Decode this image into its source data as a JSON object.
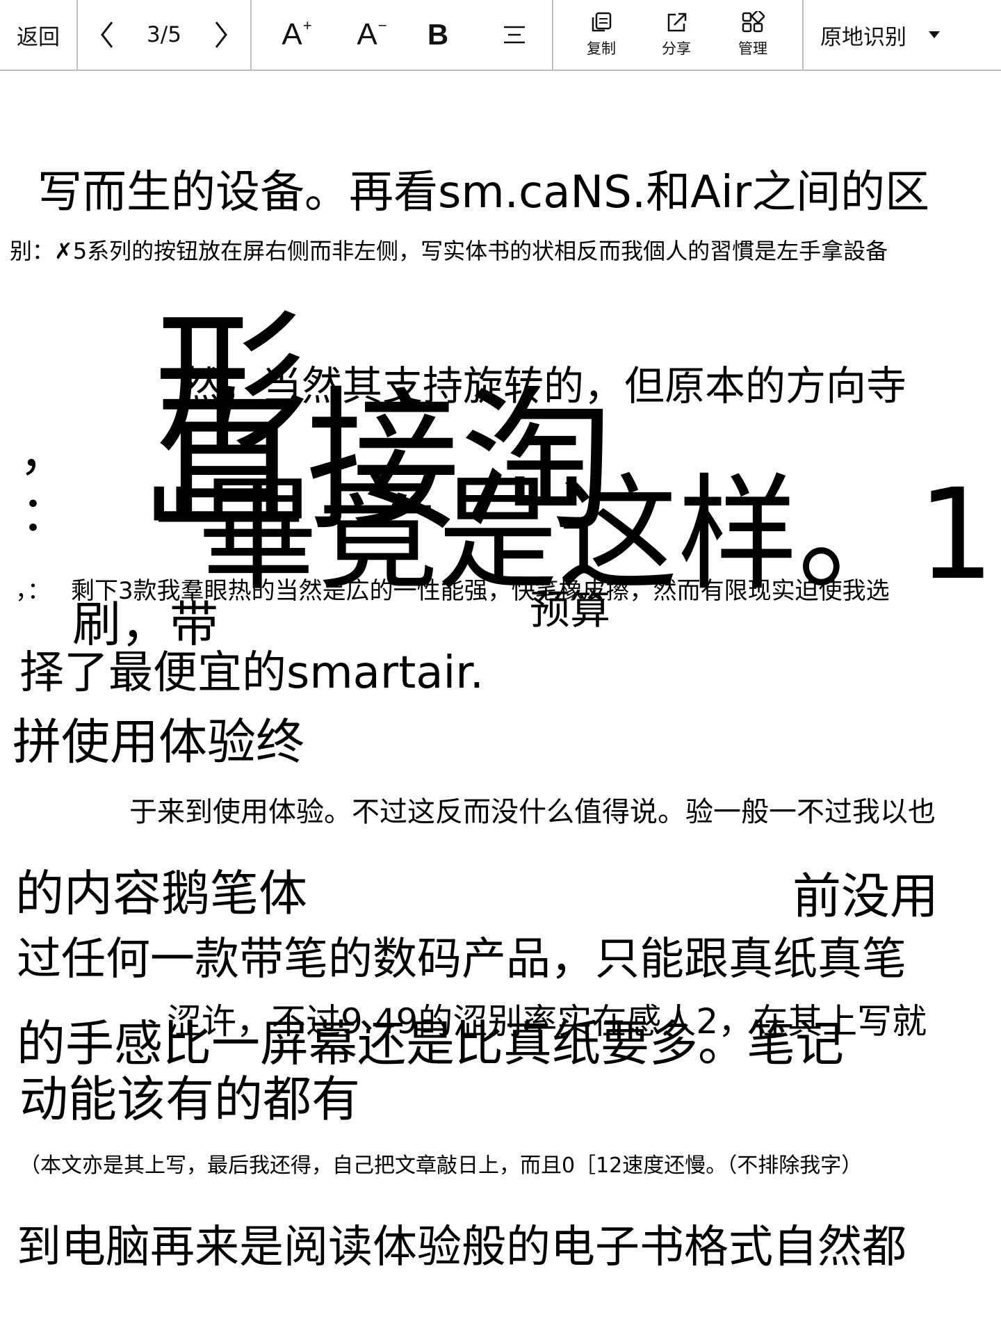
{
  "toolbar": {
    "back_label": "返回",
    "page_indicator": "3/5",
    "prev_glyph": "〈",
    "next_glyph": "〉",
    "font_increase_glyph": "A",
    "font_increase_sup": "+",
    "font_decrease_glyph": "A",
    "font_decrease_sup": "−",
    "bold_glyph": "B",
    "copy_label": "复制",
    "share_label": "分享",
    "manage_label": "管理",
    "recognize_mode": "原地识别"
  },
  "content": {
    "lines": [
      "写而生的设备。再看sm.caNS.和Air之间的区",
      "别：✗5系列的按钮放在屏右侧而非左侧，写实体书的状相反而我個人的習慣是左手拿設备",
      "形",
      "直接淘",
      "然，当然其支持旋转的，但原本的方向寺",
      "，",
      "：",
      "\"畢竟是这样。1",
      "，：",
      "剩下3款我羣眼热的当然是広的一性能强，快笔橡皮擦，然而有限现实迫使我选",
      "刷，带",
      "预算",
      "择了最便宜的smartair.",
      "拼使用体验终",
      "于来到使用体验。不过这反而没什么值得说。验一般一不过我以也",
      "的内容鹅笔体",
      "前没用",
      "过任何一款带笔的数码产品，只能跟真纸真笔",
      "涩许，不过9.49的涩别率实在感人2，在其上写就",
      "的手感比一屏幕还是比真纸要多。笔记",
      "动能该有的都有",
      "（本文亦是其上写，最后我还得，自己把文章敲日上，而且0［12速度还慢。（不排除我字）",
      "到电脑再来是阅读体验般的电子书格式自然都"
    ]
  }
}
